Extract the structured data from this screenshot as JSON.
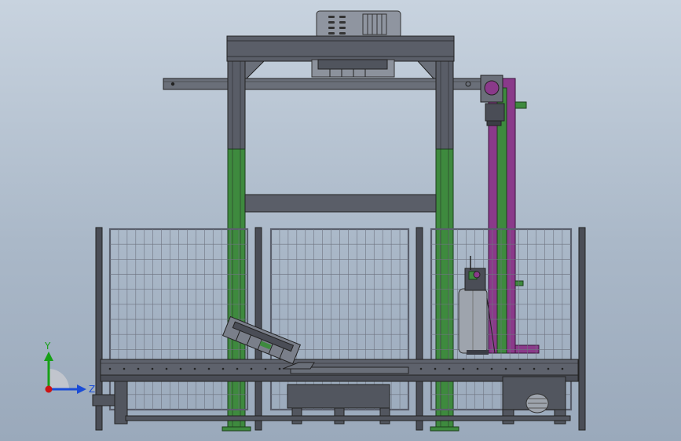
{
  "viewport": {
    "background_top": "#c8d3df",
    "background_bottom": "#9aa9bb"
  },
  "colors": {
    "steel_dark": "#4a4d56",
    "steel_mid": "#5a5e68",
    "steel_light": "#7a7f8a",
    "frame_green": "#3e8a3e",
    "column_purple": "#8a3a8a",
    "fence_line": "#6e7380",
    "motor_silver": "#9ea4ad",
    "axis_y": "#16a016",
    "axis_z": "#1a4cd6",
    "axis_x": "#cc1414"
  },
  "triad": {
    "y_label": "Y",
    "z_label": "Z",
    "icon": "coordinate-triad-icon"
  }
}
